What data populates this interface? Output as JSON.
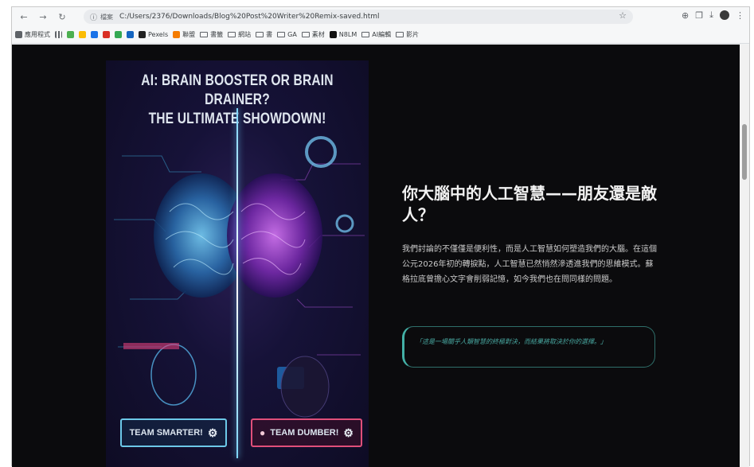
{
  "browser": {
    "url": "C:/Users/2376/Downloads/Blog%20Post%20Writer%20Remix-saved.html",
    "url_chip": "檔案",
    "bookmarks": [
      {
        "label": "應用程式",
        "type": "app",
        "color": "#5f6368"
      },
      {
        "label": "",
        "type": "grid",
        "color": "#5f6368"
      },
      {
        "label": "",
        "type": "icon",
        "color": "#4caf50"
      },
      {
        "label": "",
        "type": "icon",
        "color": "#fbbc04"
      },
      {
        "label": "",
        "type": "icon",
        "color": "#1a73e8"
      },
      {
        "label": "",
        "type": "icon",
        "color": "#d93025"
      },
      {
        "label": "",
        "type": "icon",
        "color": "#34a853"
      },
      {
        "label": "",
        "type": "icon",
        "color": "#1565c0"
      },
      {
        "label": "Pexels",
        "type": "icon",
        "color": "#222222"
      },
      {
        "label": "聯盟",
        "type": "icon",
        "color": "#f57c00"
      },
      {
        "label": "書籤",
        "type": "folder"
      },
      {
        "label": "網站",
        "type": "folder"
      },
      {
        "label": "書",
        "type": "folder"
      },
      {
        "label": "GA",
        "type": "folder"
      },
      {
        "label": "素材",
        "type": "folder"
      },
      {
        "label": "N8LM",
        "type": "icon",
        "color": "#111111"
      },
      {
        "label": "AI編輯",
        "type": "folder"
      },
      {
        "label": "影片",
        "type": "folder"
      }
    ]
  },
  "poster": {
    "title_line1": "AI: BRAIN BOOSTER OR BRAIN DRAINER?",
    "title_line2": "THE ULTIMATE SHOWDOWN!",
    "team_smarter": "TEAM SMARTER!",
    "team_dumber": "TEAM DUMBER!"
  },
  "article": {
    "heading": "你大腦中的人工智慧——朋友還是敵人？",
    "paragraph": "我們討論的不僅僅是便利性，而是人工智慧如何塑造我們的大腦。在這個公元2026年初的轉捩點，人工智慧已然悄然滲透進我們的思維模式。蘇格拉底曾擔心文字會削弱記憶，如今我們也在問同樣的問題。",
    "quote": "「這是一場關乎人類智慧的終極對決，而結果將取決於你的選擇。」"
  },
  "colors": {
    "page_bg": "#0b0b0d",
    "smarter_border": "#6cc8e8",
    "dumber_border": "#e04f7a",
    "quote_accent": "#43b0a6"
  }
}
